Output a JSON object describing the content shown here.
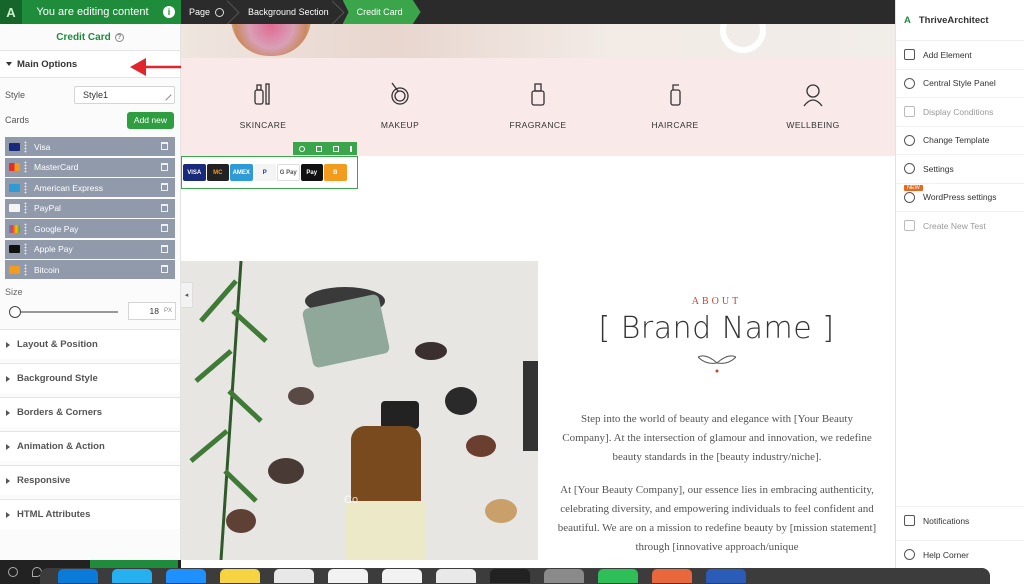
{
  "top_bar": {
    "logo": "A",
    "editing_text": "You are editing content",
    "info": "i",
    "breadcrumbs": [
      "Page",
      "Background Section",
      "Credit Card"
    ]
  },
  "left_panel": {
    "title": "Credit Card",
    "main_options": "Main Options",
    "style_label": "Style",
    "style_value": "Style1",
    "cards_label": "Cards",
    "add_new": "Add new",
    "cards": [
      "Visa",
      "MasterCard",
      "American Express",
      "PayPal",
      "Google Pay",
      "Apple Pay",
      "Bitcoin"
    ],
    "size_label": "Size",
    "size_value": "18",
    "size_unit": "PX",
    "size_fraction": 0.0,
    "sections": [
      "Layout & Position",
      "Background Style",
      "Borders & Corners",
      "Animation & Action",
      "Responsive",
      "HTML Attributes"
    ]
  },
  "canvas": {
    "categories": [
      "SKINCARE",
      "MAKEUP",
      "FRAGRANCE",
      "HAIRCARE",
      "WELLBEING"
    ],
    "payment_badges": [
      "VISA",
      "MC",
      "AMEX",
      "P",
      "G Pay",
      "Pay",
      "B"
    ],
    "about": "ABOUT",
    "brand_name": "[ Brand Name ]",
    "paragraph_1": "Step into the world of beauty and elegance with [Your Beauty Company]. At the intersection of glamour and innovation, we redefine beauty standards in the [beauty industry/niche].",
    "paragraph_2": "At [Your Beauty Company], our essence lies in embracing authenticity, celebrating diversity, and empowering individuals to feel confident and beautiful. We are on a mission to redefine beauty by [mission statement] through [innovative approach/unique",
    "bottle_text": "Co"
  },
  "right_panel": {
    "brand": "ThriveArchitect",
    "logo": "A",
    "items": [
      "Add Element",
      "Central Style Panel",
      "Display Conditions",
      "Change Template",
      "Settings",
      "WordPress settings",
      "Create New Test"
    ],
    "new_badge": "NEW",
    "notifications": "Notifications",
    "help": "Help Corner",
    "bar_fragment": "bar"
  },
  "colors": {
    "accent": "#1f8c3c",
    "card_row": "#909aab",
    "pink_band": "#f9e9e9",
    "about_red": "#c2462f"
  }
}
